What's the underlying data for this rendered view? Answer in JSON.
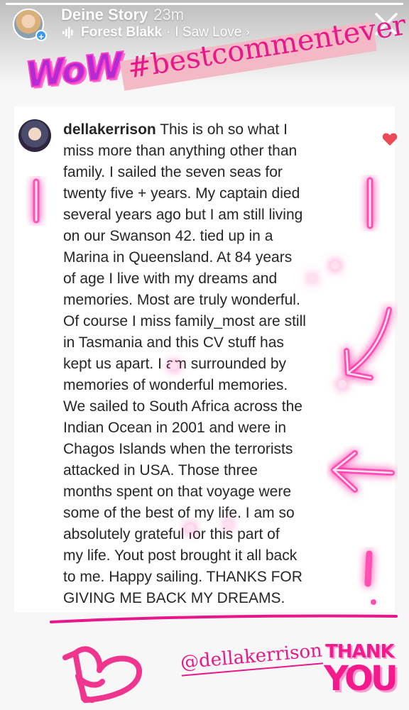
{
  "story": {
    "title": "Deine Story",
    "time": "23m",
    "progress": 1.0
  },
  "music": {
    "artist": "Forest Blakk",
    "separator": "·",
    "song": "I Saw Love",
    "chevron": "›",
    "icon": "music-bars-icon"
  },
  "stickers": {
    "wow": "WoW",
    "hashtag": "#bestcommentever",
    "mention": "@dellakerrison",
    "thank": "THANK",
    "you": "YOU"
  },
  "comment": {
    "username": "dellakerrison",
    "text": " This is oh so what I\nmiss more than anything other than\nfamily. I sailed the seven seas for\ntwenty five + years. My captain died\nseveral years ago but I am still living\non our Swanson 42. tied up in a\nMarina in Queensland. At 84 years\nof age I live with my dreams and\nmemories. Most are truly  wonderful.\nOf course I miss family_most are still\nin Tasmania and this CV stuff has\nkept us apart. I am surrounded by\nmemories of wonderful memories.\nWe sailed to South Africa across the\nIndian Ocean in 2001 and were in\nChagos Islands when the terrorists\nattacked in USA. Those three\nmonths spent on that voyage were\nsome of the best of my life. I am so\nabsolutely grateful for this part of\nmy life. Yout post brought it all back\nto me. Happy sailing. THANKS FOR\nGIVING ME BACK MY DREAMS.",
    "liked": true
  },
  "colors": {
    "accent_pink": "#e8188c",
    "neon_pink": "#ff4fb4",
    "like_red": "#ed4956",
    "badge_blue": "#3897f0"
  },
  "icons": {
    "close": "close-icon",
    "add": "add-story-icon",
    "heart": "heart-icon"
  }
}
